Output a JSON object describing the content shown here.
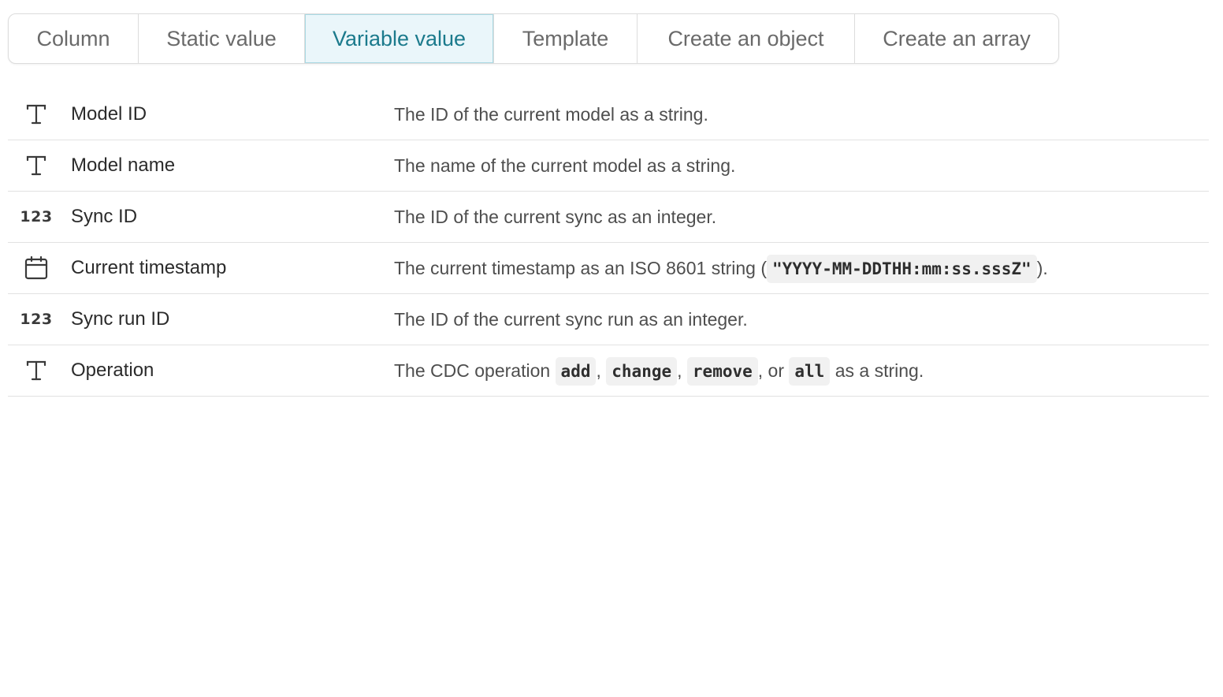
{
  "tabs": [
    {
      "label": "Column"
    },
    {
      "label": "Static value"
    },
    {
      "label": "Variable value",
      "active": true
    },
    {
      "label": "Template"
    },
    {
      "label": "Create an object"
    },
    {
      "label": "Create an array"
    }
  ],
  "variables": [
    {
      "icon": "text-type-icon",
      "name": "Model ID",
      "description": "The ID of the current model as a string."
    },
    {
      "icon": "text-type-icon",
      "name": "Model name",
      "description": "The name of the current model as a string."
    },
    {
      "icon": "number-type-icon",
      "icon_text": "123",
      "name": "Sync ID",
      "description": "The ID of the current sync as an integer."
    },
    {
      "icon": "calendar-icon",
      "name": "Current timestamp",
      "description_prefix": "The current timestamp as an ISO 8601 string (",
      "description_code": "\"YYYY-MM-DDTHH:mm:ss.sssZ\"",
      "description_suffix": ")."
    },
    {
      "icon": "number-type-icon",
      "icon_text": "123",
      "name": "Sync run ID",
      "description": "The ID of the current sync run as an integer."
    },
    {
      "icon": "text-type-icon",
      "name": "Operation",
      "description_prefix": "The CDC operation ",
      "description_codes": [
        "add",
        "change",
        "remove",
        "all"
      ],
      "description_sep_1": ", ",
      "description_sep_2": ", ",
      "description_sep_3": ", or ",
      "description_suffix": " as a string."
    }
  ],
  "colors": {
    "active_tab_bg": "#eaf6fa",
    "active_tab_text": "#1b7a8c",
    "tab_text": "#6a6a6a",
    "divider": "#e2e2e2"
  }
}
